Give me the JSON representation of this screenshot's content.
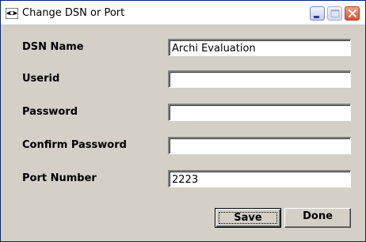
{
  "window": {
    "title": "Change DSN or Port",
    "icon": "eye-icon",
    "controls": [
      "minimize-icon",
      "maximize-icon",
      "close-icon"
    ]
  },
  "form": {
    "dsn_name": {
      "label": "DSN Name",
      "value": "Archi Evaluation"
    },
    "userid": {
      "label": "Userid",
      "value": ""
    },
    "password": {
      "label": "Password",
      "value": ""
    },
    "confirm_password": {
      "label": "Confirm Password",
      "value": ""
    },
    "port_number": {
      "label": "Port Number",
      "value": "2223"
    }
  },
  "buttons": {
    "save_label": "Save",
    "done_label": "Done"
  },
  "colors": {
    "dialog_background": "#d4d0c8",
    "close_button": "#d4532b",
    "titlebar_background": "#ffffff"
  }
}
